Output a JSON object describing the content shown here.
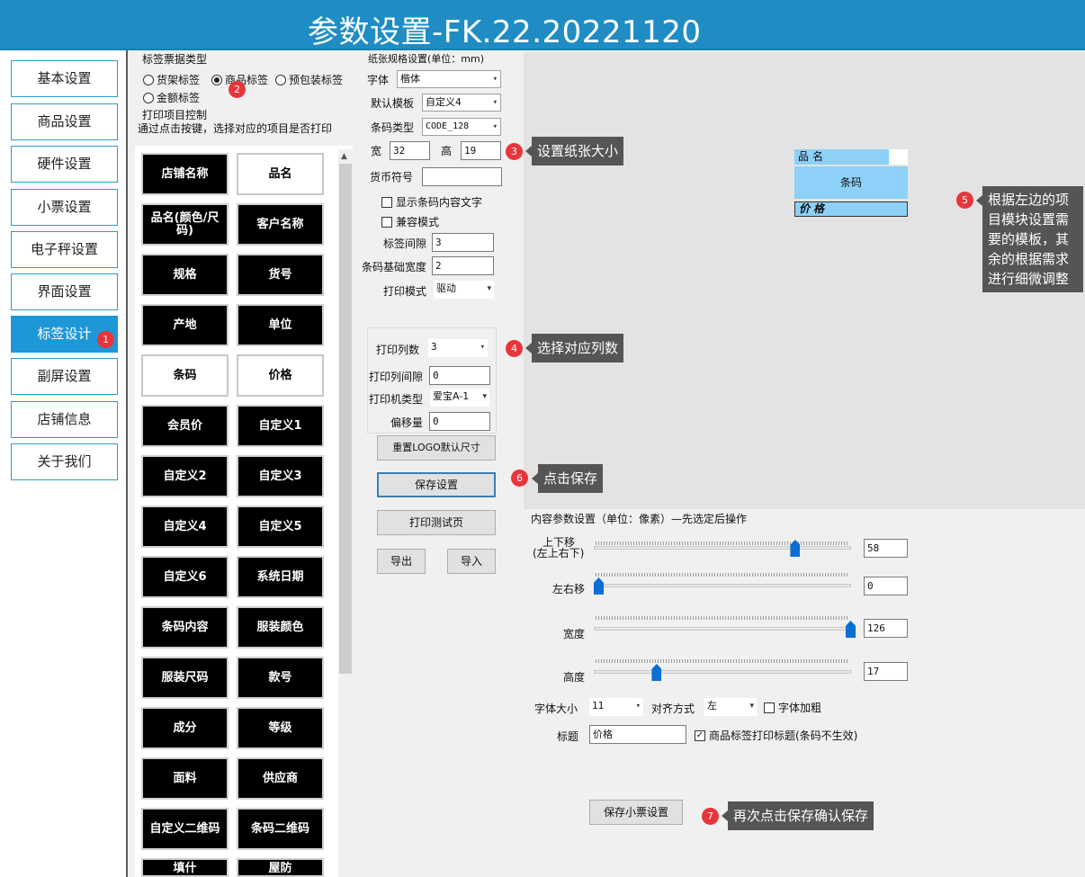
{
  "window": {
    "title": "参数设置-FK.22.20221120"
  },
  "sidebar": {
    "items": [
      {
        "label": "基本设置"
      },
      {
        "label": "商品设置"
      },
      {
        "label": "硬件设置"
      },
      {
        "label": "小票设置"
      },
      {
        "label": "电子秤设置"
      },
      {
        "label": "界面设置"
      },
      {
        "label": "标签设计"
      },
      {
        "label": "副屏设置"
      },
      {
        "label": "店铺信息"
      },
      {
        "label": "关于我们"
      }
    ],
    "active": "标签设计"
  },
  "label_type": {
    "legend": "标签票据类型",
    "options": [
      "货架标签",
      "商品标签",
      "预包装标签",
      "金额标签"
    ],
    "selected": "商品标签"
  },
  "print_items": {
    "legend": "打印项目控制",
    "hint": "通过点击按键，选择对应的项目是否打印",
    "buttons": [
      {
        "label": "店铺名称",
        "selected": false
      },
      {
        "label": "品名",
        "selected": true
      },
      {
        "label": "品名(颜色/尺码)",
        "selected": false
      },
      {
        "label": "客户名称",
        "selected": false
      },
      {
        "label": "规格",
        "selected": false
      },
      {
        "label": "货号",
        "selected": false
      },
      {
        "label": "产地",
        "selected": false
      },
      {
        "label": "单位",
        "selected": false
      },
      {
        "label": "条码",
        "selected": true
      },
      {
        "label": "价格",
        "selected": true
      },
      {
        "label": "会员价",
        "selected": false
      },
      {
        "label": "自定义1",
        "selected": false
      },
      {
        "label": "自定义2",
        "selected": false
      },
      {
        "label": "自定义3",
        "selected": false
      },
      {
        "label": "自定义4",
        "selected": false
      },
      {
        "label": "自定义5",
        "selected": false
      },
      {
        "label": "自定义6",
        "selected": false
      },
      {
        "label": "系统日期",
        "selected": false
      },
      {
        "label": "条码内容",
        "selected": false
      },
      {
        "label": "服装颜色",
        "selected": false
      },
      {
        "label": "服装尺码",
        "selected": false
      },
      {
        "label": "款号",
        "selected": false
      },
      {
        "label": "成分",
        "selected": false
      },
      {
        "label": "等级",
        "selected": false
      },
      {
        "label": "面料",
        "selected": false
      },
      {
        "label": "供应商",
        "selected": false
      },
      {
        "label": "自定义二维码",
        "selected": false
      },
      {
        "label": "条码二维码",
        "selected": false
      },
      {
        "label": "填什",
        "selected": false
      },
      {
        "label": "屋防",
        "selected": false
      }
    ]
  },
  "paper": {
    "legend": "纸张规格设置(单位：mm)",
    "font_label": "字体",
    "font_value": "楷体",
    "template_label": "默认模板",
    "template_value": "自定义4",
    "barcode_type_label": "条码类型",
    "barcode_type_value": "CODE_128",
    "width_label": "宽",
    "width_value": "32",
    "height_label": "高",
    "height_value": "19",
    "currency_label": "货币符号",
    "currency_value": "",
    "show_barcode_text": "显示条码内容文字",
    "compat_mode": "兼容模式",
    "gap_label": "标签间隙",
    "gap_value": "3",
    "barcode_width_label": "条码基础宽度",
    "barcode_width_value": "2",
    "print_mode_label": "打印模式",
    "print_mode_value": "驱动",
    "columns_label": "打印列数",
    "columns_value": "3",
    "col_gap_label": "打印列间隙",
    "col_gap_value": "0",
    "printer_type_label": "打印机类型",
    "printer_type_value": "爱宝A-1",
    "offset_label": "偏移量",
    "offset_value": "0",
    "reset_logo_button": "重置LOGO默认尺寸",
    "save_button": "保存设置",
    "test_print_button": "打印测试页",
    "export_button": "导出",
    "import_button": "导入"
  },
  "preview": {
    "row1": "品名",
    "row2": "条码",
    "row3": "价格"
  },
  "content": {
    "legend": "内容参数设置（单位：像素）—先选定后操作",
    "vertical_label_1": "上下移",
    "vertical_label_2": "(左上右下)",
    "vertical_value": "58",
    "vertical_level": 0.78,
    "horizontal_label": "左右移",
    "horizontal_value": "0",
    "horizontal_level": 0.0,
    "width_label": "宽度",
    "width_value": "126",
    "width_level": 1.0,
    "height_label": "高度",
    "height_value": "17",
    "height_level": 0.23,
    "font_size_label": "字体大小",
    "font_size_value": "11",
    "align_label": "对齐方式",
    "align_value": "左",
    "bold_label": "字体加粗",
    "title_label": "标题",
    "title_value": "价格",
    "print_title_label": "商品标签打印标题(条码不生效)",
    "save_button": "保存小票设置"
  },
  "annotations": [
    {
      "num": "1"
    },
    {
      "num": "2"
    },
    {
      "num": "3",
      "text": "设置纸张大小"
    },
    {
      "num": "4",
      "text": "选择对应列数"
    },
    {
      "num": "5",
      "text": "根据左边的项目模块设置需要的模板，其余的根据需求进行细微调整"
    },
    {
      "num": "6",
      "text": "点击保存"
    },
    {
      "num": "7",
      "text": "再次点击保存确认保存"
    }
  ],
  "colors": {
    "titlebar": "#1f8dc4",
    "active_nav": "#1e97d8",
    "preview_field": "#8dd0f8",
    "badge": "#e8353a",
    "callout": "#555555"
  }
}
